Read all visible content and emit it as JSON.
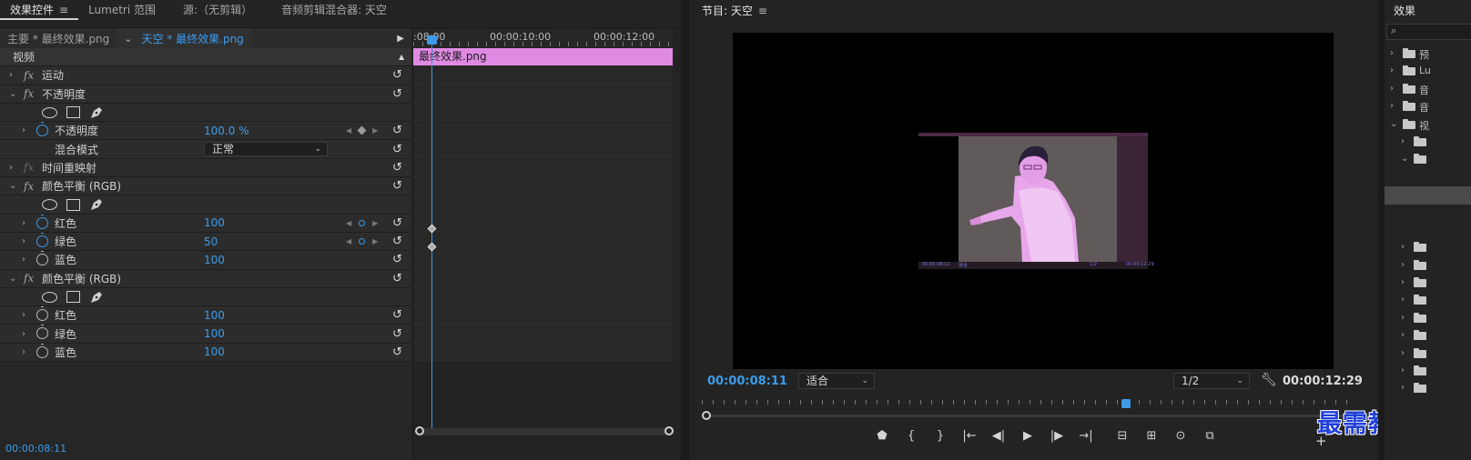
{
  "effect_controls": {
    "tabs": [
      {
        "label": "效果控件",
        "active": true
      },
      {
        "label": "Lumetri 范围",
        "active": false
      },
      {
        "label": "源:（无剪辑）",
        "active": false
      },
      {
        "label": "音频剪辑混合器: 天空",
        "active": false
      }
    ],
    "menu_glyph": "≡",
    "master_label": "主要 * 最终效果.png",
    "sequence_label": "天空 * 最终效果.png",
    "rows": [
      {
        "type": "section",
        "name": "视频"
      },
      {
        "type": "effect",
        "fx": true,
        "name": "运动"
      },
      {
        "type": "effect",
        "fx": true,
        "expanded": true,
        "name": "不透明度"
      },
      {
        "type": "shapes"
      },
      {
        "type": "param",
        "name": "不透明度",
        "value": "100.0 %",
        "stopwatch": true,
        "keyframes": "diamond"
      },
      {
        "type": "select",
        "name": "混合模式",
        "value": "正常"
      },
      {
        "type": "effect",
        "fx": false,
        "name": "时间重映射"
      },
      {
        "type": "effect",
        "fx": true,
        "expanded": true,
        "name": "颜色平衡 (RGB)"
      },
      {
        "type": "shapes"
      },
      {
        "type": "param",
        "name": "红色",
        "value": "100",
        "stopwatch": true,
        "keyframes": "dot"
      },
      {
        "type": "param",
        "name": "绿色",
        "value": "50",
        "stopwatch": true,
        "keyframes": "dot"
      },
      {
        "type": "param",
        "name": "蓝色",
        "value": "100",
        "stopwatch": false
      },
      {
        "type": "effect",
        "fx": true,
        "expanded": true,
        "name": "颜色平衡 (RGB)"
      },
      {
        "type": "shapes"
      },
      {
        "type": "param",
        "name": "红色",
        "value": "100",
        "stopwatch": false
      },
      {
        "type": "param",
        "name": "绿色",
        "value": "100",
        "stopwatch": false
      },
      {
        "type": "param",
        "name": "蓝色",
        "value": "100",
        "stopwatch": false
      }
    ],
    "timeline": {
      "ruler": [
        ":08:00",
        "00:00:10:00",
        "00:00:12:00"
      ],
      "clip_name": "最终效果.png",
      "bottom_timecode": "00:00:08:11"
    }
  },
  "program_monitor": {
    "title": "节目: 天空",
    "menu_glyph": "≡",
    "timecode_current": "00:00:08:11",
    "fit_dropdown": "适合",
    "resolution_dropdown": "1/2",
    "timecode_duration": "00:00:12:29",
    "mini_bar_left": "00:00:08:11",
    "mini_bar_mid": "适合",
    "mini_bar_right": "00:00:12:29",
    "mini_bar_res": "1/2",
    "transport_icons": [
      "marker-icon",
      "mark-in-icon",
      "mark-out-icon",
      "go-to-in-icon",
      "step-back-icon",
      "play-icon",
      "step-forward-icon",
      "go-to-out-icon",
      "lift-icon",
      "extract-icon",
      "export-frame-icon",
      "compare-icon"
    ],
    "transport_glyphs": [
      "⬟",
      "{",
      "}",
      "|←",
      "◀|",
      "▶",
      "|▶",
      "→|",
      "⊟",
      "⊞",
      "⊙",
      "⧉"
    ],
    "add_button": "+",
    "watermark": "最需教育"
  },
  "effects_panel": {
    "title": "效果",
    "search_glyph": "⌕",
    "items": [
      {
        "label": "预",
        "level": 0
      },
      {
        "label": "Lu",
        "level": 0
      },
      {
        "label": "音",
        "level": 0
      },
      {
        "label": "音",
        "level": 0
      },
      {
        "label": "视",
        "level": 0,
        "expanded": true
      },
      {
        "label": "",
        "level": 1
      },
      {
        "label": "",
        "level": 1,
        "expanded": true
      },
      {
        "label": "",
        "level": 2
      },
      {
        "label": "",
        "level": 2,
        "selected": true
      },
      {
        "label": "",
        "level": 2
      },
      {
        "label": "",
        "level": 2
      },
      {
        "label": "",
        "level": 1
      },
      {
        "label": "",
        "level": 1
      },
      {
        "label": "",
        "level": 1
      },
      {
        "label": "",
        "level": 1
      },
      {
        "label": "",
        "level": 1
      },
      {
        "label": "",
        "level": 1
      },
      {
        "label": "",
        "level": 1
      },
      {
        "label": "",
        "level": 1
      },
      {
        "label": "",
        "level": 1
      }
    ]
  },
  "colors": {
    "accent_blue": "#3d9be9",
    "clip_pink": "#e08ae4",
    "panel_bg": "#232323",
    "watermark_blue": "#2140d8"
  }
}
